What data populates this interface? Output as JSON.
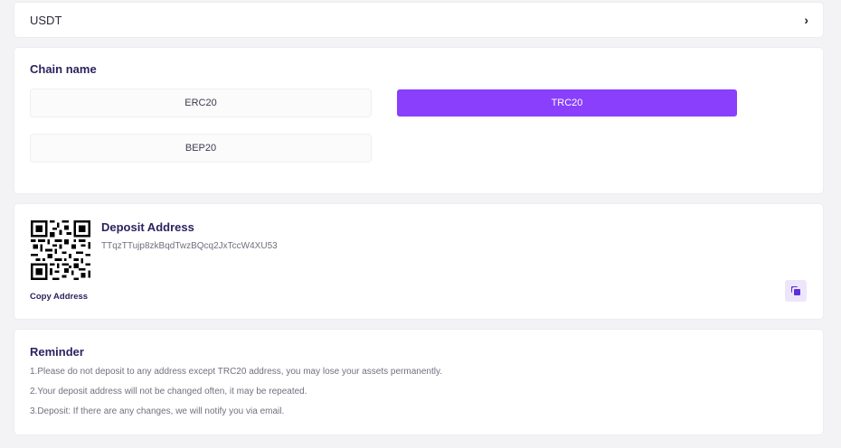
{
  "coin": {
    "label": "USDT",
    "chevron": "›"
  },
  "chain": {
    "title": "Chain name",
    "options": [
      "ERC20",
      "TRC20",
      "BEP20"
    ],
    "selected": "TRC20",
    "accent_color": "#8a3ffc"
  },
  "deposit": {
    "title": "Deposit Address",
    "address": "TTqzTTujp8zkBqdTwzBQcq2JxTccW4XU53",
    "copy_label": "Copy Address",
    "copy_icon": "copy-icon"
  },
  "reminder": {
    "title": "Reminder",
    "lines": [
      "1.Please do not deposit to any address except TRC20 address, you may lose your assets permanently.",
      "2.Your deposit address will not be changed often, it may be repeated.",
      "3.Deposit: If there are any changes, we will notify you via email."
    ]
  }
}
